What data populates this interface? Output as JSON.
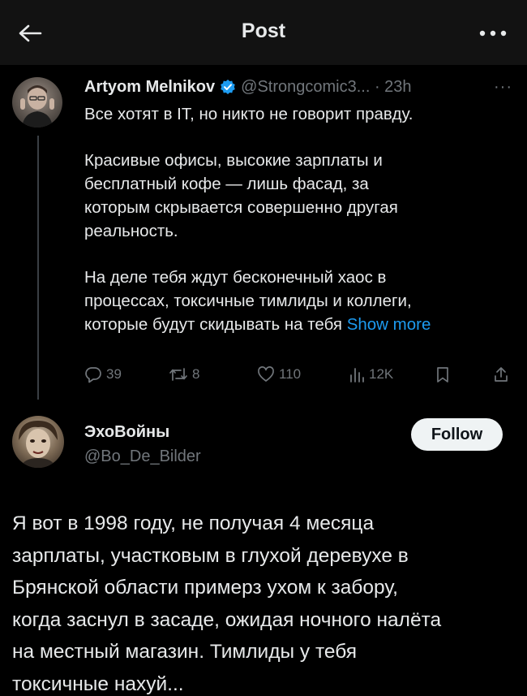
{
  "header": {
    "title": "Post",
    "back_icon": "arrow-left-icon",
    "more_icon": "more-horizontal-icon"
  },
  "quoted_post": {
    "author_name": "Artyom Melnikov",
    "verified": true,
    "handle_time": "@Strongcomic3... · 23h",
    "more_label": "···",
    "paragraphs": [
      "Все хотят в IT, но никто не говорит правду.",
      "Красивые офисы, высокие зарплаты и\nбесплатный кофе — лишь фасад, за\nкоторым скрывается совершенно другая\nреальность.",
      "На деле тебя ждут бесконечный хаос в\nпроцессах, токсичные тимлиды и коллеги,\nкоторые будут скидывать на тебя "
    ],
    "show_more": "Show more",
    "actions": {
      "replies": "39",
      "reposts": "8",
      "likes": "110",
      "views": "12K"
    }
  },
  "reply_post": {
    "author_name": "ЭхоВойны",
    "handle": "@Bo_De_Bilder",
    "follow_label": "Follow",
    "text": "Я вот в 1998 году, не получая 4 месяца\nзарплаты, участковым в глухой деревухе в\nБрянской области примерз ухом к забору,\nкогда заснул в засаде, ожидая ночного налёта\nна местный магазин. Тимлиды у тебя\nтоксичные нахуй..."
  },
  "colors": {
    "background": "#000000",
    "header_bg": "#121212",
    "text": "#e7e9ea",
    "muted": "#71767b",
    "accent": "#1d9bf0",
    "follow_bg": "#eff3f4"
  }
}
